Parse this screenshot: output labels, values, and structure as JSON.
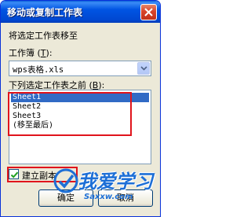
{
  "window": {
    "title": "移动或复制工作表"
  },
  "labels": {
    "move_to": "将选定工作表移至",
    "workbook_prefix": "工作簿 (",
    "workbook_key": "T",
    "workbook_suffix": "):",
    "before_prefix": "下列选定工作表之前 (",
    "before_key": "B",
    "before_suffix": "):"
  },
  "workbook": {
    "selected": "wps表格.xls"
  },
  "sheets": {
    "items": [
      "Sheet1",
      "Sheet2",
      "Sheet3",
      "(移至最后)"
    ],
    "selected_index": 0
  },
  "copy_option": {
    "label": "建立副本",
    "checked": true
  },
  "buttons": {
    "ok": "确定",
    "cancel": "取消"
  },
  "watermark": {
    "text": "我爱学习",
    "url": "Saxxw.com"
  },
  "colors": {
    "titlebar": "#0054e3",
    "highlight": "#316ac5",
    "annotation_red": "#e0141c",
    "watermark": "#1d6fd6"
  }
}
